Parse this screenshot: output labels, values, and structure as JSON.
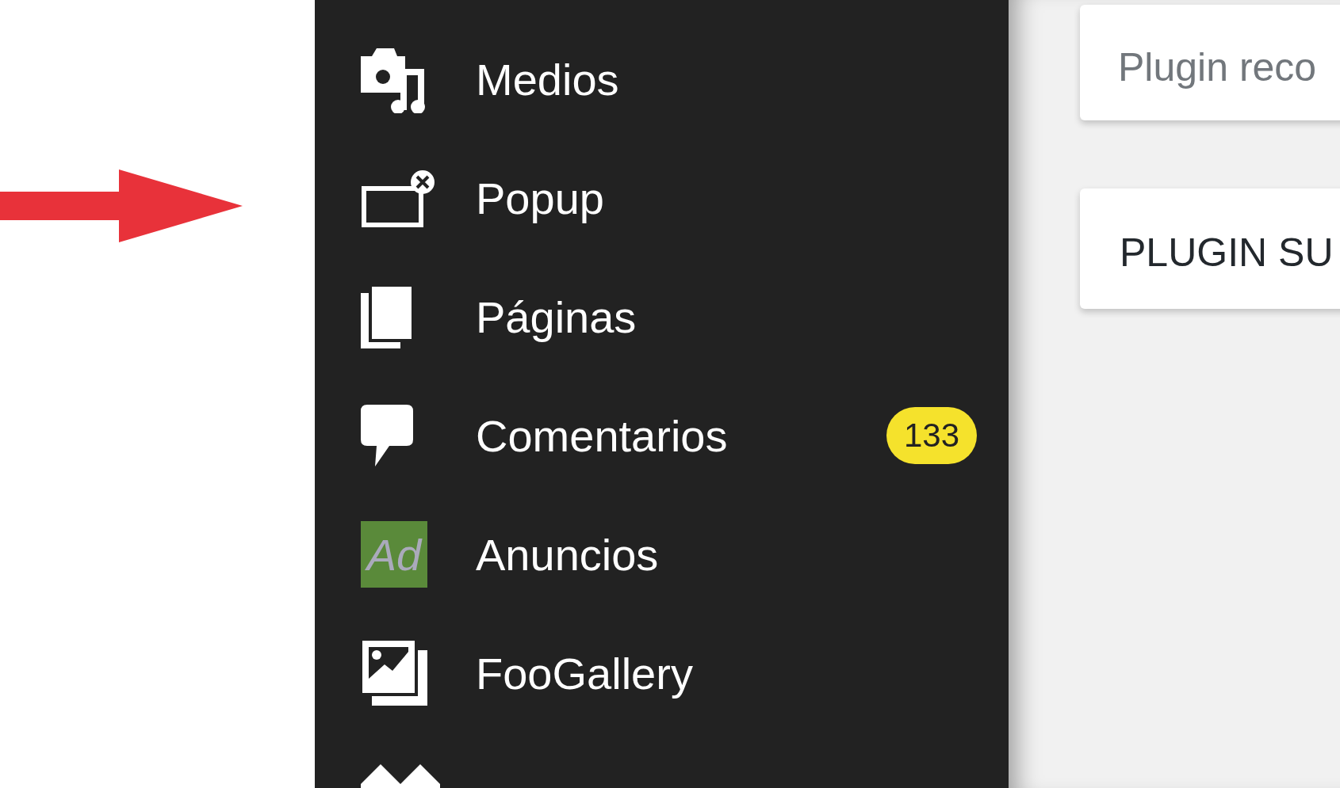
{
  "sidebar": {
    "items": [
      {
        "label": "Medios"
      },
      {
        "label": "Popup"
      },
      {
        "label": "Páginas"
      },
      {
        "label": "Comentarios",
        "badge": "133"
      },
      {
        "label": "Anuncios",
        "icon_text": "Ad"
      },
      {
        "label": "FooGallery"
      }
    ]
  },
  "cards": [
    {
      "text": "Plugin reco",
      "kind": "normal"
    },
    {
      "text": "PLUGIN SU",
      "kind": "heading"
    }
  ]
}
